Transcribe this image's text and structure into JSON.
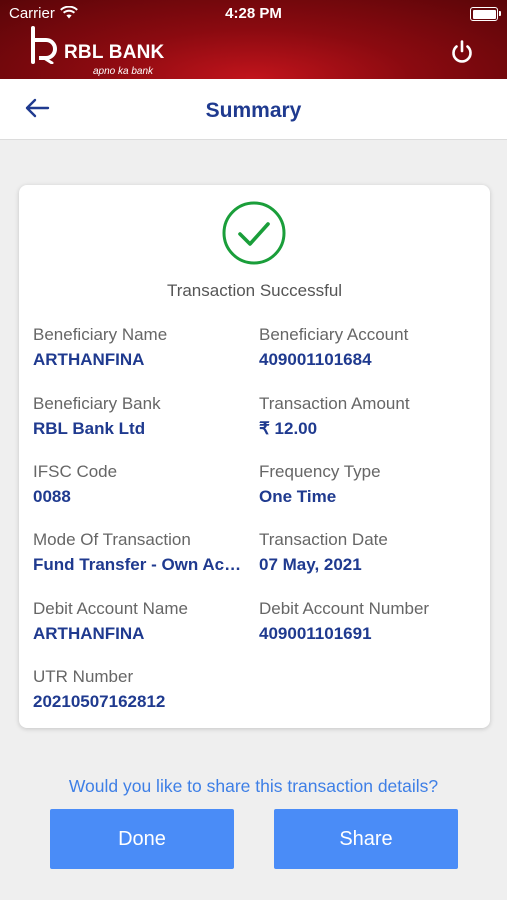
{
  "status_bar": {
    "carrier": "Carrier",
    "time": "4:28 PM"
  },
  "brand": {
    "name": "RBL BANK",
    "tagline": "apno ka bank"
  },
  "nav": {
    "title": "Summary"
  },
  "icons": {
    "back": "back-arrow-icon",
    "power": "power-icon",
    "success": "check-circle-icon"
  },
  "colors": {
    "header": "#8a0a10",
    "accent_blue": "#1f3a8f",
    "success_green": "#1a9e3a",
    "button": "#4a8cf7"
  },
  "card": {
    "status": "Transaction Successful",
    "fields": [
      {
        "label": "Beneficiary Name",
        "value": "ARTHANFINA"
      },
      {
        "label": "Beneficiary Account",
        "value": "409001101684"
      },
      {
        "label": "Beneficiary Bank",
        "value": "RBL Bank Ltd"
      },
      {
        "label": "Transaction Amount",
        "value": "₹ 12.00"
      },
      {
        "label": "IFSC Code",
        "value": "0088"
      },
      {
        "label": "Frequency Type",
        "value": "One Time"
      },
      {
        "label": "Mode Of Transaction",
        "value": "Fund Transfer - Own Account"
      },
      {
        "label": "Transaction Date",
        "value": "07 May, 2021"
      },
      {
        "label": "Debit Account Name",
        "value": "ARTHANFINA"
      },
      {
        "label": "Debit Account Number",
        "value": "409001101691"
      },
      {
        "label": "UTR Number",
        "value": "20210507162812"
      }
    ]
  },
  "share_prompt": "Would you like to share this transaction details?",
  "buttons": {
    "done": "Done",
    "share": "Share"
  }
}
